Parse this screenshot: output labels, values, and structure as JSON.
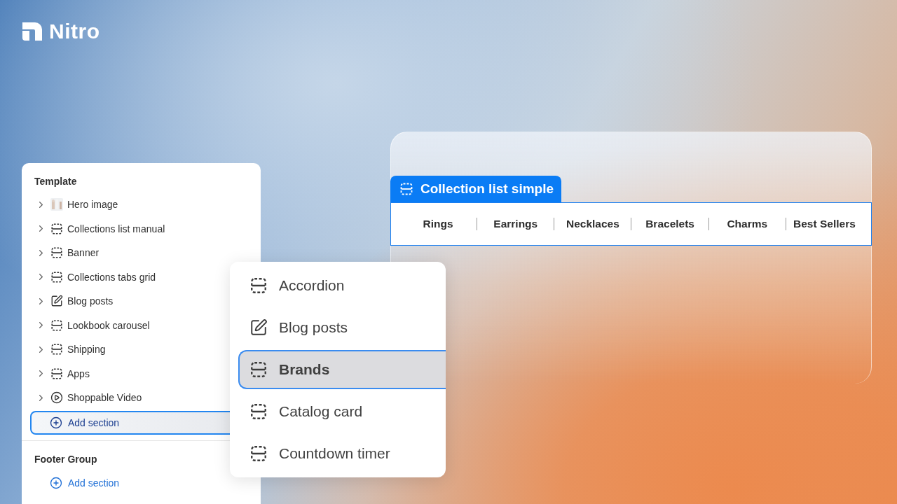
{
  "brand": {
    "name": "Nitro"
  },
  "template_panel": {
    "title": "Template",
    "items": [
      {
        "label": "Hero image"
      },
      {
        "label": "Collections list manual",
        "kind": "section"
      },
      {
        "label": "Banner",
        "kind": "section"
      },
      {
        "label": "Collections tabs grid",
        "kind": "section"
      },
      {
        "label": "Blog posts",
        "kind": "blog"
      },
      {
        "label": "Lookbook carousel",
        "kind": "section"
      },
      {
        "label": "Shipping",
        "kind": "section"
      },
      {
        "label": "Apps",
        "kind": "section"
      },
      {
        "label": "Shoppable Video",
        "kind": "video"
      }
    ],
    "add_section": {
      "label": "Add section",
      "selected": true
    }
  },
  "footer_group": {
    "title": "Footer Group",
    "add_section": {
      "label": "Add section",
      "selected": false
    }
  },
  "section_menu": {
    "items": [
      {
        "label": "Accordion",
        "kind": "section",
        "selected": false
      },
      {
        "label": "Blog posts",
        "kind": "blog",
        "selected": false
      },
      {
        "label": "Brands",
        "kind": "section",
        "selected": true
      },
      {
        "label": "Catalog card",
        "kind": "section",
        "selected": false
      },
      {
        "label": "Countdown timer",
        "kind": "section",
        "selected": false
      }
    ]
  },
  "preview": {
    "tag": "Collection list simple",
    "collections": [
      "Rings",
      "Earrings",
      "Necklaces",
      "Bracelets",
      "Charms",
      "Best Sellers"
    ]
  }
}
